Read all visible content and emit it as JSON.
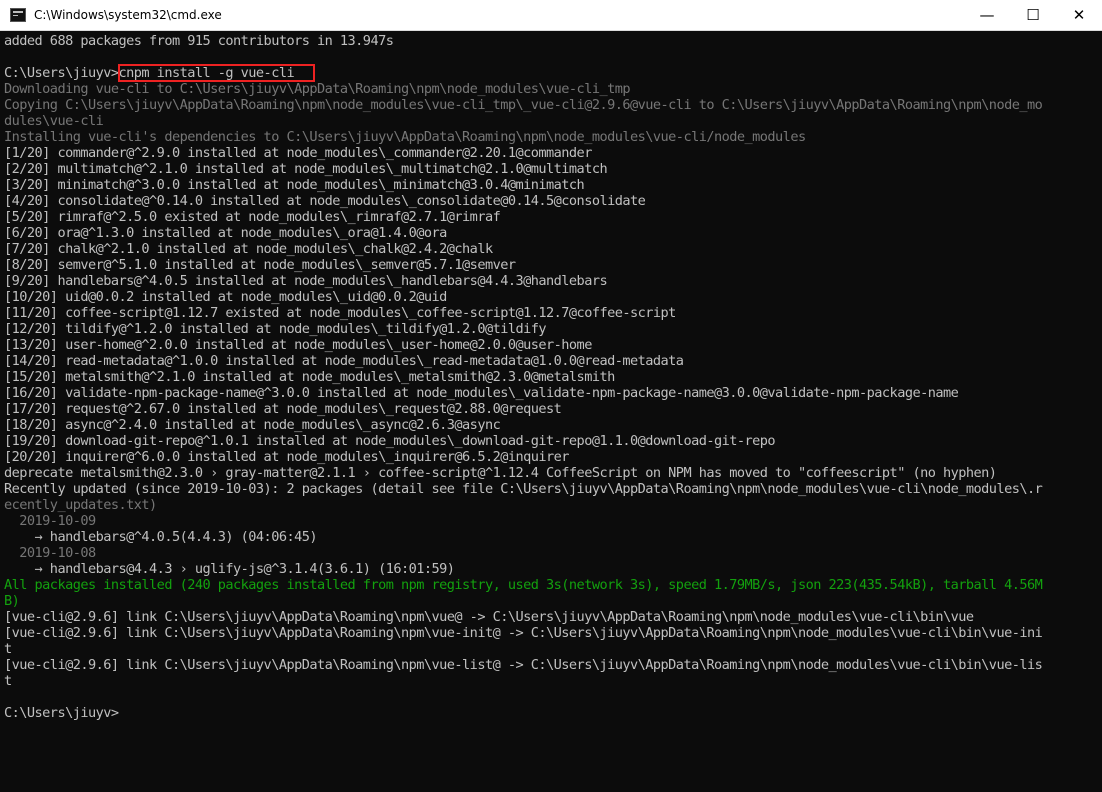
{
  "window": {
    "title": "C:\\Windows\\system32\\cmd.exe",
    "minimize": "—",
    "maximize": "☐",
    "close": "✕"
  },
  "lines": [
    {
      "t": "added 688 packages from 915 contributors in 13.947s"
    },
    {
      "t": ""
    },
    {
      "t": "C:\\Users\\jiuyv>cnpm install -g vue-cli",
      "highlight": "cnpm install -g vue-cli"
    },
    {
      "t": "Downloading vue-cli to C:\\Users\\jiuyv\\AppData\\Roaming\\npm\\node_modules\\vue-cli_tmp",
      "c": "gray"
    },
    {
      "t": "Copying C:\\Users\\jiuyv\\AppData\\Roaming\\npm\\node_modules\\vue-cli_tmp\\_vue-cli@2.9.6@vue-cli to C:\\Users\\jiuyv\\AppData\\Roaming\\npm\\node_mo",
      "c": "gray"
    },
    {
      "t": "dules\\vue-cli",
      "c": "gray"
    },
    {
      "t": "Installing vue-cli's dependencies to C:\\Users\\jiuyv\\AppData\\Roaming\\npm\\node_modules\\vue-cli/node_modules",
      "c": "gray"
    },
    {
      "t": "[1/20] commander@^2.9.0 installed at node_modules\\_commander@2.20.1@commander"
    },
    {
      "t": "[2/20] multimatch@^2.1.0 installed at node_modules\\_multimatch@2.1.0@multimatch"
    },
    {
      "t": "[3/20] minimatch@^3.0.0 installed at node_modules\\_minimatch@3.0.4@minimatch"
    },
    {
      "t": "[4/20] consolidate@^0.14.0 installed at node_modules\\_consolidate@0.14.5@consolidate"
    },
    {
      "t": "[5/20] rimraf@^2.5.0 existed at node_modules\\_rimraf@2.7.1@rimraf"
    },
    {
      "t": "[6/20] ora@^1.3.0 installed at node_modules\\_ora@1.4.0@ora"
    },
    {
      "t": "[7/20] chalk@^2.1.0 installed at node_modules\\_chalk@2.4.2@chalk"
    },
    {
      "t": "[8/20] semver@^5.1.0 installed at node_modules\\_semver@5.7.1@semver"
    },
    {
      "t": "[9/20] handlebars@^4.0.5 installed at node_modules\\_handlebars@4.4.3@handlebars"
    },
    {
      "t": "[10/20] uid@0.0.2 installed at node_modules\\_uid@0.0.2@uid"
    },
    {
      "t": "[11/20] coffee-script@1.12.7 existed at node_modules\\_coffee-script@1.12.7@coffee-script"
    },
    {
      "t": "[12/20] tildify@^1.2.0 installed at node_modules\\_tildify@1.2.0@tildify"
    },
    {
      "t": "[13/20] user-home@^2.0.0 installed at node_modules\\_user-home@2.0.0@user-home"
    },
    {
      "t": "[14/20] read-metadata@^1.0.0 installed at node_modules\\_read-metadata@1.0.0@read-metadata"
    },
    {
      "t": "[15/20] metalsmith@^2.1.0 installed at node_modules\\_metalsmith@2.3.0@metalsmith"
    },
    {
      "t": "[16/20] validate-npm-package-name@^3.0.0 installed at node_modules\\_validate-npm-package-name@3.0.0@validate-npm-package-name"
    },
    {
      "t": "[17/20] request@^2.67.0 installed at node_modules\\_request@2.88.0@request"
    },
    {
      "t": "[18/20] async@^2.4.0 installed at node_modules\\_async@2.6.3@async"
    },
    {
      "t": "[19/20] download-git-repo@^1.0.1 installed at node_modules\\_download-git-repo@1.1.0@download-git-repo"
    },
    {
      "t": "[20/20] inquirer@^6.0.0 installed at node_modules\\_inquirer@6.5.2@inquirer"
    },
    {
      "t": "deprecate metalsmith@2.3.0 › gray-matter@2.1.1 › coffee-script@^1.12.4 CoffeeScript on NPM has moved to \"coffeescript\" (no hyphen)"
    },
    {
      "t": "Recently updated (since 2019-10-03): 2 packages (detail see file C:\\Users\\jiuyv\\AppData\\Roaming\\npm\\node_modules\\vue-cli\\node_modules\\.r"
    },
    {
      "t": "ecently_updates.txt)",
      "c": "gray"
    },
    {
      "t": "  2019-10-09",
      "c": "gray"
    },
    {
      "t": "    → handlebars@^4.0.5(4.4.3) (04:06:45)"
    },
    {
      "t": "  2019-10-08",
      "c": "gray"
    },
    {
      "t": "    → handlebars@4.4.3 › uglify-js@^3.1.4(3.6.1) (16:01:59)"
    },
    {
      "t": "All packages installed (240 packages installed from npm registry, used 3s(network 3s), speed 1.79MB/s, json 223(435.54kB), tarball 4.56M",
      "c": "g"
    },
    {
      "t": "B)",
      "c": "g"
    },
    {
      "t": "[vue-cli@2.9.6] link C:\\Users\\jiuyv\\AppData\\Roaming\\npm\\vue@ -> C:\\Users\\jiuyv\\AppData\\Roaming\\npm\\node_modules\\vue-cli\\bin\\vue"
    },
    {
      "t": "[vue-cli@2.9.6] link C:\\Users\\jiuyv\\AppData\\Roaming\\npm\\vue-init@ -> C:\\Users\\jiuyv\\AppData\\Roaming\\npm\\node_modules\\vue-cli\\bin\\vue-ini"
    },
    {
      "t": "t"
    },
    {
      "t": "[vue-cli@2.9.6] link C:\\Users\\jiuyv\\AppData\\Roaming\\npm\\vue-list@ -> C:\\Users\\jiuyv\\AppData\\Roaming\\npm\\node_modules\\vue-cli\\bin\\vue-lis"
    },
    {
      "t": "t"
    },
    {
      "t": ""
    },
    {
      "t": "C:\\Users\\jiuyv>"
    }
  ]
}
